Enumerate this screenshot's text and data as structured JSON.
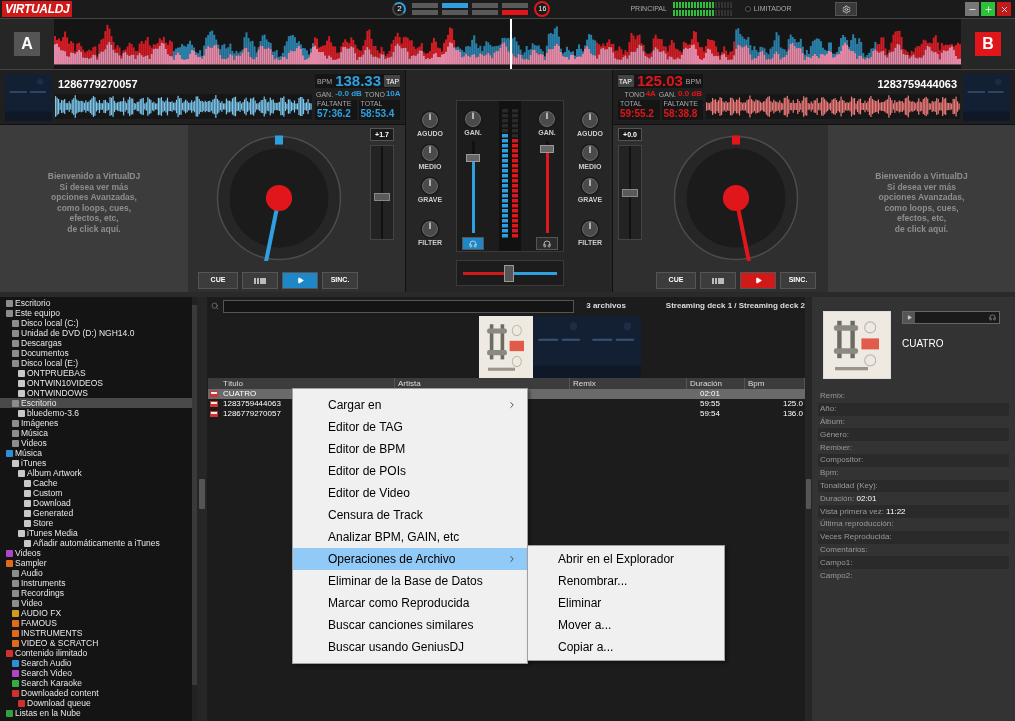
{
  "top_bar": {
    "logo": "VIRTUALDJ",
    "left_badge": "2",
    "right_badge": "16",
    "slots_top": [
      {
        "color": "#5a5a5a"
      },
      {
        "color": "#2ea0e0"
      },
      {
        "color": "#5a5a5a"
      },
      {
        "color": "#5a5a5a"
      }
    ],
    "slots_bottom": [
      {
        "color": "#5a5a5a"
      },
      {
        "color": "#5a5a5a"
      },
      {
        "color": "#5a5a5a"
      },
      {
        "color": "#e0161b"
      }
    ],
    "master_label": "PRINCIPAL",
    "master_meter": {
      "level": 0.7
    },
    "limiter_label": "LIMITADOR",
    "limiter_on": false
  },
  "decks": [
    {
      "letter": "A",
      "color": "#2ea0e0",
      "title": "1286779270057",
      "bpm_label": "BPM",
      "bpm": "138.33",
      "tap": "TAP",
      "gain_label": "GAN.",
      "gain": "-0.0 dB",
      "key_label": "TONO",
      "key": "10A",
      "remain_label": "FALTANTE",
      "remain": "57:36.2",
      "total_label": "TOTAL",
      "total": "58:53.4",
      "welcome": "Bienvenido a VirtualDJ\nSi desea ver más\nopciones Avanzadas,\ncomo loops, cues,\nefectos, etc,\nde click aquí.",
      "pitch": "+1.7",
      "pitch_slider": {
        "level": 0.45
      },
      "cue": "CUE",
      "sync": "SINC.",
      "playing": true
    },
    {
      "letter": "B",
      "color": "#e0161b",
      "title": "1283759444063",
      "bpm_label": "BPM",
      "bpm": "125.03",
      "tap": "TAP",
      "gain_label": "GAN.",
      "gain": "0.0 dB",
      "key_label": "TONO",
      "key": "4A",
      "remain_label": "FALTANTE",
      "remain": "58:38.8",
      "total_label": "TOTAL",
      "total": "59:55.2",
      "welcome": "Bienvenido a VirtualDJ\nSi desea ver más\nopciones Avanzadas,\ncomo loops, cues,\nefectos, etc,\nde click aquí.",
      "pitch": "+0.0",
      "pitch_slider": {
        "level": 0.5
      },
      "cue": "CUE",
      "sync": "SINC.",
      "playing": true
    }
  ],
  "mixer": {
    "channels": [
      {
        "eq": [
          "AGUDO",
          "MEDIO",
          "GRAVE",
          "FILTER"
        ],
        "gain_label": "GAN.",
        "volume": {
          "level": 0.85
        },
        "vu": {
          "level": 0.8
        },
        "headphone_on": true
      },
      {
        "eq": [
          "AGUDO",
          "MEDIO",
          "GRAVE",
          "FILTER"
        ],
        "gain_label": "GAN.",
        "volume": {
          "level": 0.95
        },
        "vu": {
          "level": 0.75
        },
        "headphone_on": false
      }
    ],
    "crossfader": {
      "level": 0.48
    }
  },
  "sidebar": {
    "items": [
      {
        "label": "Escritorio",
        "selected": false
      },
      {
        "label": "Este equipo",
        "selected": false,
        "children": [
          {
            "label": "Disco local (C:)",
            "selected": false
          },
          {
            "label": "Unidad de DVD (D:) NGH14.0",
            "selected": false
          },
          {
            "label": "Descargas",
            "selected": false
          },
          {
            "label": "Documentos",
            "selected": false
          },
          {
            "label": "Disco local (E:)",
            "selected": false,
            "children": [
              {
                "label": "ONTPRUEBAS",
                "selected": false,
                "color": "#c8c8c8"
              },
              {
                "label": "ONTWIN10VIDEOS",
                "selected": false,
                "color": "#c8c8c8"
              },
              {
                "label": "ONTWINDOWS",
                "selected": false,
                "color": "#c8c8c8"
              }
            ]
          },
          {
            "label": "Escritorio",
            "selected": true,
            "children": [
              {
                "label": "bluedemo-3.6",
                "selected": false,
                "color": "#c8c8c8"
              }
            ]
          },
          {
            "label": "Imágenes",
            "selected": false
          },
          {
            "label": "Música",
            "selected": false
          },
          {
            "label": "Videos",
            "selected": false
          }
        ]
      },
      {
        "label": "Música",
        "selected": false,
        "color": "#2d8fd8",
        "children": [
          {
            "label": "iTunes",
            "selected": false,
            "color": "#c8c8c8",
            "children": [
              {
                "label": "Album Artwork",
                "selected": false,
                "color": "#c8c8c8",
                "children": [
                  {
                    "label": "Cache",
                    "selected": false,
                    "color": "#c8c8c8"
                  },
                  {
                    "label": "Custom",
                    "selected": false,
                    "color": "#c8c8c8"
                  },
                  {
                    "label": "Download",
                    "selected": false,
                    "color": "#c8c8c8"
                  },
                  {
                    "label": "Generated",
                    "selected": false,
                    "color": "#c8c8c8"
                  },
                  {
                    "label": "Store",
                    "selected": false,
                    "color": "#c8c8c8"
                  }
                ]
              },
              {
                "label": "iTunes Media",
                "selected": false,
                "color": "#c8c8c8",
                "children": [
                  {
                    "label": "Añadir automáticamente a iTunes",
                    "selected": false,
                    "color": "#c8c8c8"
                  }
                ]
              }
            ]
          }
        ]
      },
      {
        "label": "Videos",
        "selected": false,
        "color": "#b044c8"
      },
      {
        "label": "Sampler",
        "selected": false,
        "color": "#e06a1a",
        "children": [
          {
            "label": "Audio",
            "selected": false
          },
          {
            "label": "Instruments",
            "selected": false
          },
          {
            "label": "Recordings",
            "selected": false
          },
          {
            "label": "Video",
            "selected": false
          },
          {
            "label": "AUDIO FX",
            "selected": false,
            "color": "#d49a20"
          },
          {
            "label": "FAMOUS",
            "selected": false,
            "color": "#e06a1a"
          },
          {
            "label": "INSTRUMENTS",
            "selected": false,
            "color": "#e06a1a"
          },
          {
            "label": "VIDEO & SCRATCH",
            "selected": false,
            "color": "#e06a1a"
          }
        ]
      },
      {
        "label": "Contenido ilimitado",
        "selected": false,
        "color": "#d03030",
        "children": [
          {
            "label": "Search Audio",
            "selected": false,
            "color": "#2d8fd8"
          },
          {
            "label": "Search Video",
            "selected": false,
            "color": "#b044c8"
          },
          {
            "label": "Search Karaoke",
            "selected": false,
            "color": "#30b040"
          },
          {
            "label": "Downloaded content",
            "selected": false,
            "color": "#d03030",
            "children": [
              {
                "label": "Download queue",
                "selected": false,
                "color": "#d03030"
              }
            ]
          }
        ]
      },
      {
        "label": "Listas en la Nube",
        "selected": false,
        "color": "#30a040"
      }
    ]
  },
  "browser": {
    "file_count": "3 archivos",
    "sources": "Streaming deck 1 / Streaming deck 2",
    "columns": [
      "Título",
      "Artista",
      "Remix",
      "Duración",
      "Bpm"
    ],
    "rows": [
      {
        "title": "CUATRO",
        "duration": "02:01",
        "selected": true
      },
      {
        "title": "1283759444063",
        "duration": "59:55",
        "bpm": "125.0",
        "selected": false
      },
      {
        "title": "1286779270057",
        "duration": "59:54",
        "bpm": "136.0",
        "selected": false
      }
    ]
  },
  "context_menu": {
    "items": [
      {
        "label": "Cargar en",
        "submenu": true,
        "selected": false
      },
      {
        "label": "Editor de TAG",
        "submenu": false,
        "selected": false
      },
      {
        "label": "Editor de BPM",
        "submenu": false,
        "selected": false
      },
      {
        "label": "Editor de POIs",
        "submenu": false,
        "selected": false
      },
      {
        "label": "Editor de Video",
        "submenu": false,
        "selected": false
      },
      {
        "label": "Censura de Track",
        "submenu": false,
        "selected": false
      },
      {
        "label": "Analizar BPM, GAIN, etc",
        "submenu": false,
        "selected": false
      },
      {
        "label": "Operaciones de Archivo",
        "submenu": true,
        "selected": true
      },
      {
        "label": "Eliminar de la Base de Datos",
        "submenu": false,
        "selected": false
      },
      {
        "label": "Marcar como Reproducida",
        "submenu": false,
        "selected": false
      },
      {
        "label": "Buscar canciones similares",
        "submenu": false,
        "selected": false
      },
      {
        "label": "Buscar usando GeniusDJ",
        "submenu": false,
        "selected": false
      }
    ],
    "submenu": [
      "Abrir en el Explorador",
      "Renombrar...",
      "Eliminar",
      "Mover a...",
      "Copiar a..."
    ]
  },
  "info_panel": {
    "title": "CUATRO",
    "fields": [
      {
        "label": "Remix:"
      },
      {
        "label": "Año:"
      },
      {
        "label": "Álbum:"
      },
      {
        "label": "Género:"
      },
      {
        "label": "Remixer:"
      },
      {
        "label": "Compositor:"
      },
      {
        "label": "Bpm:"
      },
      {
        "label": "Tonalidad (Key):"
      },
      {
        "label": "Duración:",
        "value": "02:01"
      },
      {
        "label": "Vista primera vez:",
        "value": "11:22"
      },
      {
        "label": "Última reproducción:"
      },
      {
        "label": "Veces Reproducida:"
      },
      {
        "label": "Comentarios:"
      },
      {
        "label": "Campo1:"
      },
      {
        "label": "Campo2:"
      }
    ]
  }
}
